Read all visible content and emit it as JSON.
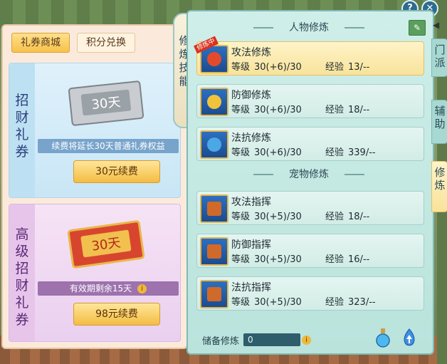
{
  "shop": {
    "tabs": [
      "礼券商城",
      "积分兑换"
    ],
    "cards": [
      {
        "side_label": "招财礼券",
        "ticket_text": "30天",
        "description": "续费将延长30天普通礼券权益",
        "button": "30元续费"
      },
      {
        "side_label": "高级招财礼券",
        "ticket_text": "30天",
        "description": "有效期剩余15天",
        "button": "98元续费"
      }
    ]
  },
  "side_label": "修炼技能",
  "panel": {
    "help": "?",
    "close": "✕",
    "sections": [
      {
        "title": "人物修炼",
        "skills": [
          {
            "name": "攻法修炼",
            "level_label": "等级",
            "level": "30(+6)/30",
            "exp_label": "经验",
            "exp": "13/--",
            "tag": "修炼中",
            "icon": "sword-icon"
          },
          {
            "name": "防御修炼",
            "level_label": "等级",
            "level": "30(+6)/30",
            "exp_label": "经验",
            "exp": "18/--",
            "icon": "shield-icon"
          },
          {
            "name": "法抗修炼",
            "level_label": "等级",
            "level": "30(+6)/30",
            "exp_label": "经验",
            "exp": "339/--",
            "icon": "yin-yang-icon"
          }
        ]
      },
      {
        "title": "宠物修炼",
        "skills": [
          {
            "name": "攻法指挥",
            "level_label": "等级",
            "level": "30(+5)/30",
            "exp_label": "经验",
            "exp": "18/--",
            "icon": "pet-attack-icon"
          },
          {
            "name": "防御指挥",
            "level_label": "等级",
            "level": "30(+5)/30",
            "exp_label": "经验",
            "exp": "16/--",
            "icon": "pet-defense-icon"
          },
          {
            "name": "法抗指挥",
            "level_label": "等级",
            "level": "30(+5)/30",
            "exp_label": "经验",
            "exp": "323/--",
            "icon": "pet-resist-icon"
          }
        ]
      }
    ],
    "storage_label": "储备修炼",
    "storage_value": "0"
  },
  "right_tabs": [
    "门派",
    "辅助",
    "修炼"
  ],
  "colors": {
    "accent_gold": "#f3bd43",
    "panel_teal": "#b9e3dc",
    "active_yellow": "#f8e39b"
  }
}
